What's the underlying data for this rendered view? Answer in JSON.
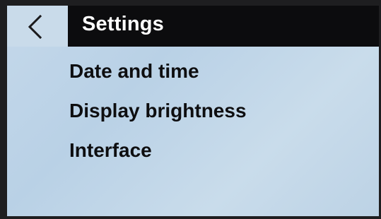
{
  "header": {
    "back_icon": "chevron-left-icon",
    "title": "Settings"
  },
  "menu": {
    "items": [
      {
        "label": "Date and time"
      },
      {
        "label": "Display brightness"
      },
      {
        "label": "Interface"
      }
    ]
  },
  "colors": {
    "title_bar": "#0c0c0e",
    "title_text": "#ffffff",
    "screen_background": "#c4d8ea",
    "item_text": "#0e0e10"
  }
}
